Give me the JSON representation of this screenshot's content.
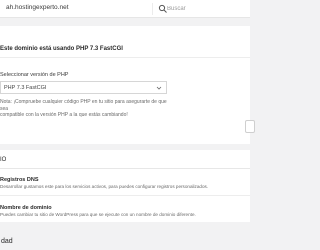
{
  "topbar": {
    "domain": "ah.hostingexperto.net",
    "search": {
      "placeholder": "Buscar"
    }
  },
  "php": {
    "heading": "Este dominio está usando PHP 7.3 FastCGI",
    "select_label": "Seleccionar versión de PHP",
    "selected_value": "PHP 7.3 FastCGI",
    "note_line_1": "Nota: ¡Compruebe cualquier código PHP en tu sitio para asegurarte de que sea",
    "note_line_2": "compatible con la versión PHP a la que estás cambiando!"
  },
  "dns_section": {
    "header": "IO",
    "items": [
      {
        "title": "Registros DNS",
        "description": "Desarrollar gustamos este para los servicios activos, para puedes configurar registros personalizados."
      },
      {
        "title": "Nombre de dominio",
        "description": "Puedes cambiar tu sitio de WordPress para que se ejecute con un nombre de dominio diferente."
      }
    ]
  },
  "bottom_section": {
    "title": "dad"
  }
}
